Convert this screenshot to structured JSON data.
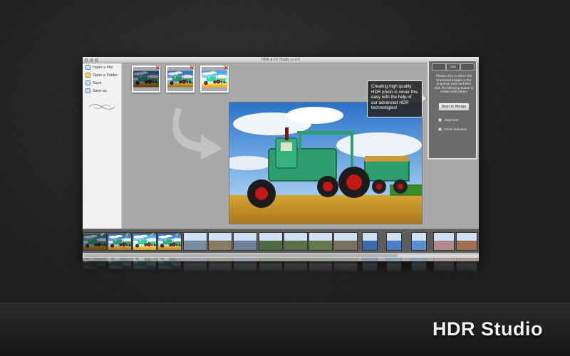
{
  "window": {
    "title": "HDR & FX Studio v1.0.0"
  },
  "brand": "HDR Studio",
  "sidebar": {
    "items": [
      {
        "label": "Open a File",
        "icon": "file-icon"
      },
      {
        "label": "Open a Folder",
        "icon": "folder-icon"
      },
      {
        "label": "Save",
        "icon": "save-icon"
      },
      {
        "label": "Save as",
        "icon": "save-as-icon"
      }
    ]
  },
  "tooltip": {
    "text": "Creating high quality HDR photo is never this easy with the help of our advanced HDR technologies!"
  },
  "merge_panel": {
    "tabs": [
      "",
      "HDR",
      ""
    ],
    "instructions": "Please click to select the bracketed images in the snapshot area and then click the following button to create HDR photo!",
    "merge_button": "Start to Merge",
    "options": [
      {
        "label": "Alignment",
        "checked": false
      },
      {
        "label": "Ghost reduction",
        "checked": false
      }
    ]
  },
  "colors": {
    "accent_check": "#9be03a",
    "remove_x": "#d20000",
    "tractor_green": "#2e9e6e"
  }
}
